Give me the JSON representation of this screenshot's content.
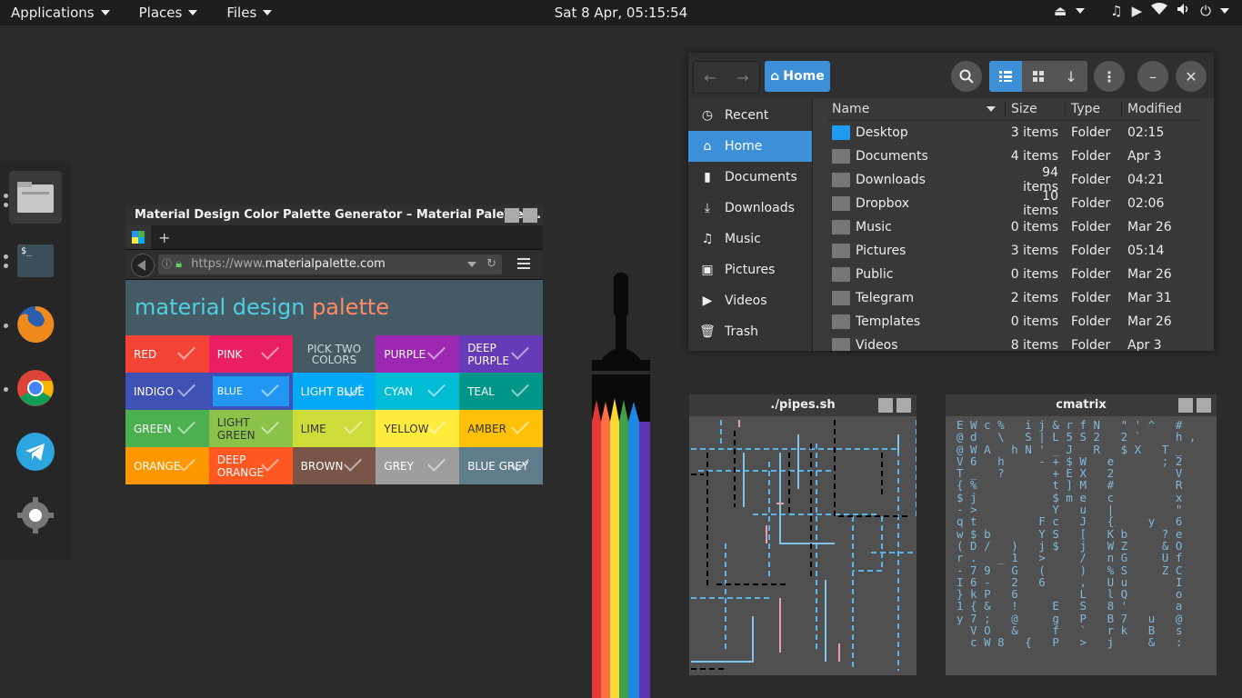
{
  "topbar": {
    "applications": "Applications",
    "places": "Places",
    "files": "Files",
    "clock": "Sat  8 Apr, 05:15:54"
  },
  "dock": {
    "apps": [
      "files-app-icon",
      "terminal-app-icon",
      "firefox-app-icon",
      "chrome-app-icon",
      "telegram-app-icon",
      "settings-app-icon"
    ],
    "terminal_glyph": "$_"
  },
  "browser": {
    "title": "Material Design Color Palette Generator – Material Palette ...",
    "new_tab": "+",
    "url_prefix": "https://www.",
    "url_domain": "materialpalette.com",
    "heading_a": "material design",
    "heading_b": "palette",
    "pick_two": "PICK TWO COLORS",
    "colors": [
      {
        "name": "RED",
        "hex": "#f44336"
      },
      {
        "name": "PINK",
        "hex": "#e91e63"
      },
      {
        "name": "",
        "hex": "#455a64"
      },
      {
        "name": "PURPLE",
        "hex": "#9c27b0"
      },
      {
        "name": "DEEP PURPLE",
        "hex": "#673ab7"
      },
      {
        "name": "INDIGO",
        "hex": "#3f51b5"
      },
      {
        "name": "BLUE",
        "hex": "#2196f3"
      },
      {
        "name": "LIGHT BLUE",
        "hex": "#03a9f4"
      },
      {
        "name": "CYAN",
        "hex": "#00bcd4"
      },
      {
        "name": "TEAL",
        "hex": "#009688"
      },
      {
        "name": "GREEN",
        "hex": "#4caf50"
      },
      {
        "name": "LIGHT GREEN",
        "hex": "#8bc34a"
      },
      {
        "name": "LIME",
        "hex": "#cddc39"
      },
      {
        "name": "YELLOW",
        "hex": "#ffeb3b"
      },
      {
        "name": "AMBER",
        "hex": "#ffc107"
      },
      {
        "name": "ORANGE",
        "hex": "#ff9800"
      },
      {
        "name": "DEEP ORANGE",
        "hex": "#ff5722"
      },
      {
        "name": "BROWN",
        "hex": "#795548"
      },
      {
        "name": "GREY",
        "hex": "#9e9e9e"
      },
      {
        "name": "BLUE GREY",
        "hex": "#607d8b"
      }
    ]
  },
  "files": {
    "location": "Home",
    "sidebar": [
      "Recent",
      "Home",
      "Documents",
      "Downloads",
      "Music",
      "Pictures",
      "Videos",
      "Trash"
    ],
    "columns": {
      "name": "Name",
      "size": "Size",
      "type": "Type",
      "modified": "Modified"
    },
    "rows": [
      {
        "name": "Desktop",
        "size": "3 items",
        "type": "Folder",
        "modified": "02:15"
      },
      {
        "name": "Documents",
        "size": "4 items",
        "type": "Folder",
        "modified": "Apr 3"
      },
      {
        "name": "Downloads",
        "size": "94 items",
        "type": "Folder",
        "modified": "04:21"
      },
      {
        "name": "Dropbox",
        "size": "10 items",
        "type": "Folder",
        "modified": "02:06"
      },
      {
        "name": "Music",
        "size": "0 items",
        "type": "Folder",
        "modified": "Mar 26"
      },
      {
        "name": "Pictures",
        "size": "3 items",
        "type": "Folder",
        "modified": "05:14"
      },
      {
        "name": "Public",
        "size": "0 items",
        "type": "Folder",
        "modified": "Mar 26"
      },
      {
        "name": "Telegram",
        "size": "2 items",
        "type": "Folder",
        "modified": "Mar 31"
      },
      {
        "name": "Templates",
        "size": "0 items",
        "type": "Folder",
        "modified": "Mar 26"
      },
      {
        "name": "Videos",
        "size": "8 items",
        "type": "Folder",
        "modified": "Apr 3"
      }
    ]
  },
  "terminals": {
    "pipes_title": "./pipes.sh",
    "cmatrix_title": "cmatrix",
    "cmatrix_lines": [
      "E W c %   i j & r f N   \" ' ^   #",
      "@ d   \\   S | L 5 S 2   2 `     h ,",
      "@ W A   h N ' _ J   R   $ X   T _",
      "V 6   h     - + $ W   e       ; 2",
      "T _   ?       + E X   2         V",
      "{ %           t ] M   #         R",
      "$ j           $ m e   c         x",
      "- >           Y   u   |         \"",
      "q t         F c   J   {     y   6",
      "w $ b       Y S   [   K b     ? e",
      "( D /   )   j $   j   W Z     & O",
      "r .   _ 1   >     /   n G     U f",
      "- 7 9   G   (     )   % S     Z C",
      "I 6 -   2   6     ,   U u       I",
      "} k P   6         L   l Q       o",
      "1 { &   !     E   S   8 '       a",
      "y 7 ;   @     g   P   B 7   u   @",
      "  V O   &     f   `   r k   B   s",
      "  c W 8   {   P   >   j     &   :"
    ]
  },
  "colors": {
    "accent": "#3d8fd8",
    "pipe_blue": "#5ab4e8",
    "pipe_pink": "#e8a0b0",
    "matrix_red": "#e86a7a"
  }
}
